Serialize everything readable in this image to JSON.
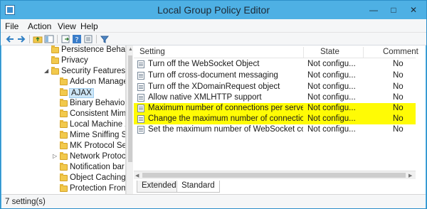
{
  "window": {
    "title": "Local Group Policy Editor",
    "minimize_glyph": "—",
    "maximize_glyph": "□",
    "close_glyph": "✕"
  },
  "menu": {
    "file": "File",
    "action": "Action",
    "view": "View",
    "help": "Help"
  },
  "toolbar": {
    "icons": [
      "back-arrow-icon",
      "forward-arrow-icon",
      "up-folder-icon",
      "show-hide-tree-icon",
      "export-list-icon",
      "help-icon",
      "properties-icon",
      "filter-icon"
    ]
  },
  "tree": {
    "items": [
      {
        "label": "Persistence Behavior",
        "expander": ""
      },
      {
        "label": "Privacy",
        "expander": ""
      },
      {
        "label": "Security Features",
        "expander": "◢"
      },
      {
        "label": "Add-on Manager",
        "expander": ""
      },
      {
        "label": "AJAX",
        "expander": ""
      },
      {
        "label": "Binary Behavior S",
        "expander": ""
      },
      {
        "label": "Consistent Mime",
        "expander": ""
      },
      {
        "label": "Local Machine Zo",
        "expander": ""
      },
      {
        "label": "Mime Sniffing Sa",
        "expander": ""
      },
      {
        "label": "MK Protocol Secu",
        "expander": ""
      },
      {
        "label": "Network Protocol",
        "expander": "▷"
      },
      {
        "label": "Notification bar",
        "expander": ""
      },
      {
        "label": "Object Caching Pr",
        "expander": ""
      },
      {
        "label": "Protection From",
        "expander": ""
      }
    ],
    "selected_label": "AJAX"
  },
  "list": {
    "headers": {
      "setting": "Setting",
      "state": "State",
      "comment": "Comment"
    },
    "rows": [
      {
        "setting": "Turn off the WebSocket Object",
        "state": "Not configu...",
        "comment": "No",
        "highlighted": false
      },
      {
        "setting": "Turn off cross-document messaging",
        "state": "Not configu...",
        "comment": "No",
        "highlighted": false
      },
      {
        "setting": "Turn off the XDomainRequest object",
        "state": "Not configu...",
        "comment": "No",
        "highlighted": false
      },
      {
        "setting": "Allow native XMLHTTP support",
        "state": "Not configu...",
        "comment": "No",
        "highlighted": false
      },
      {
        "setting": "Maximum number of connections per server (HTT...",
        "state": "Not configu...",
        "comment": "No",
        "highlighted": true
      },
      {
        "setting": "Change the maximum number of connections per ...",
        "state": "Not configu...",
        "comment": "No",
        "highlighted": true
      },
      {
        "setting": "Set the maximum number of WebSocket connecti...",
        "state": "Not configu...",
        "comment": "No",
        "highlighted": false
      }
    ],
    "highlight_color": "#fffb05"
  },
  "tabs": {
    "extended": "Extended",
    "standard": "Standard",
    "active": "Standard"
  },
  "status": {
    "text": "7 setting(s)"
  }
}
